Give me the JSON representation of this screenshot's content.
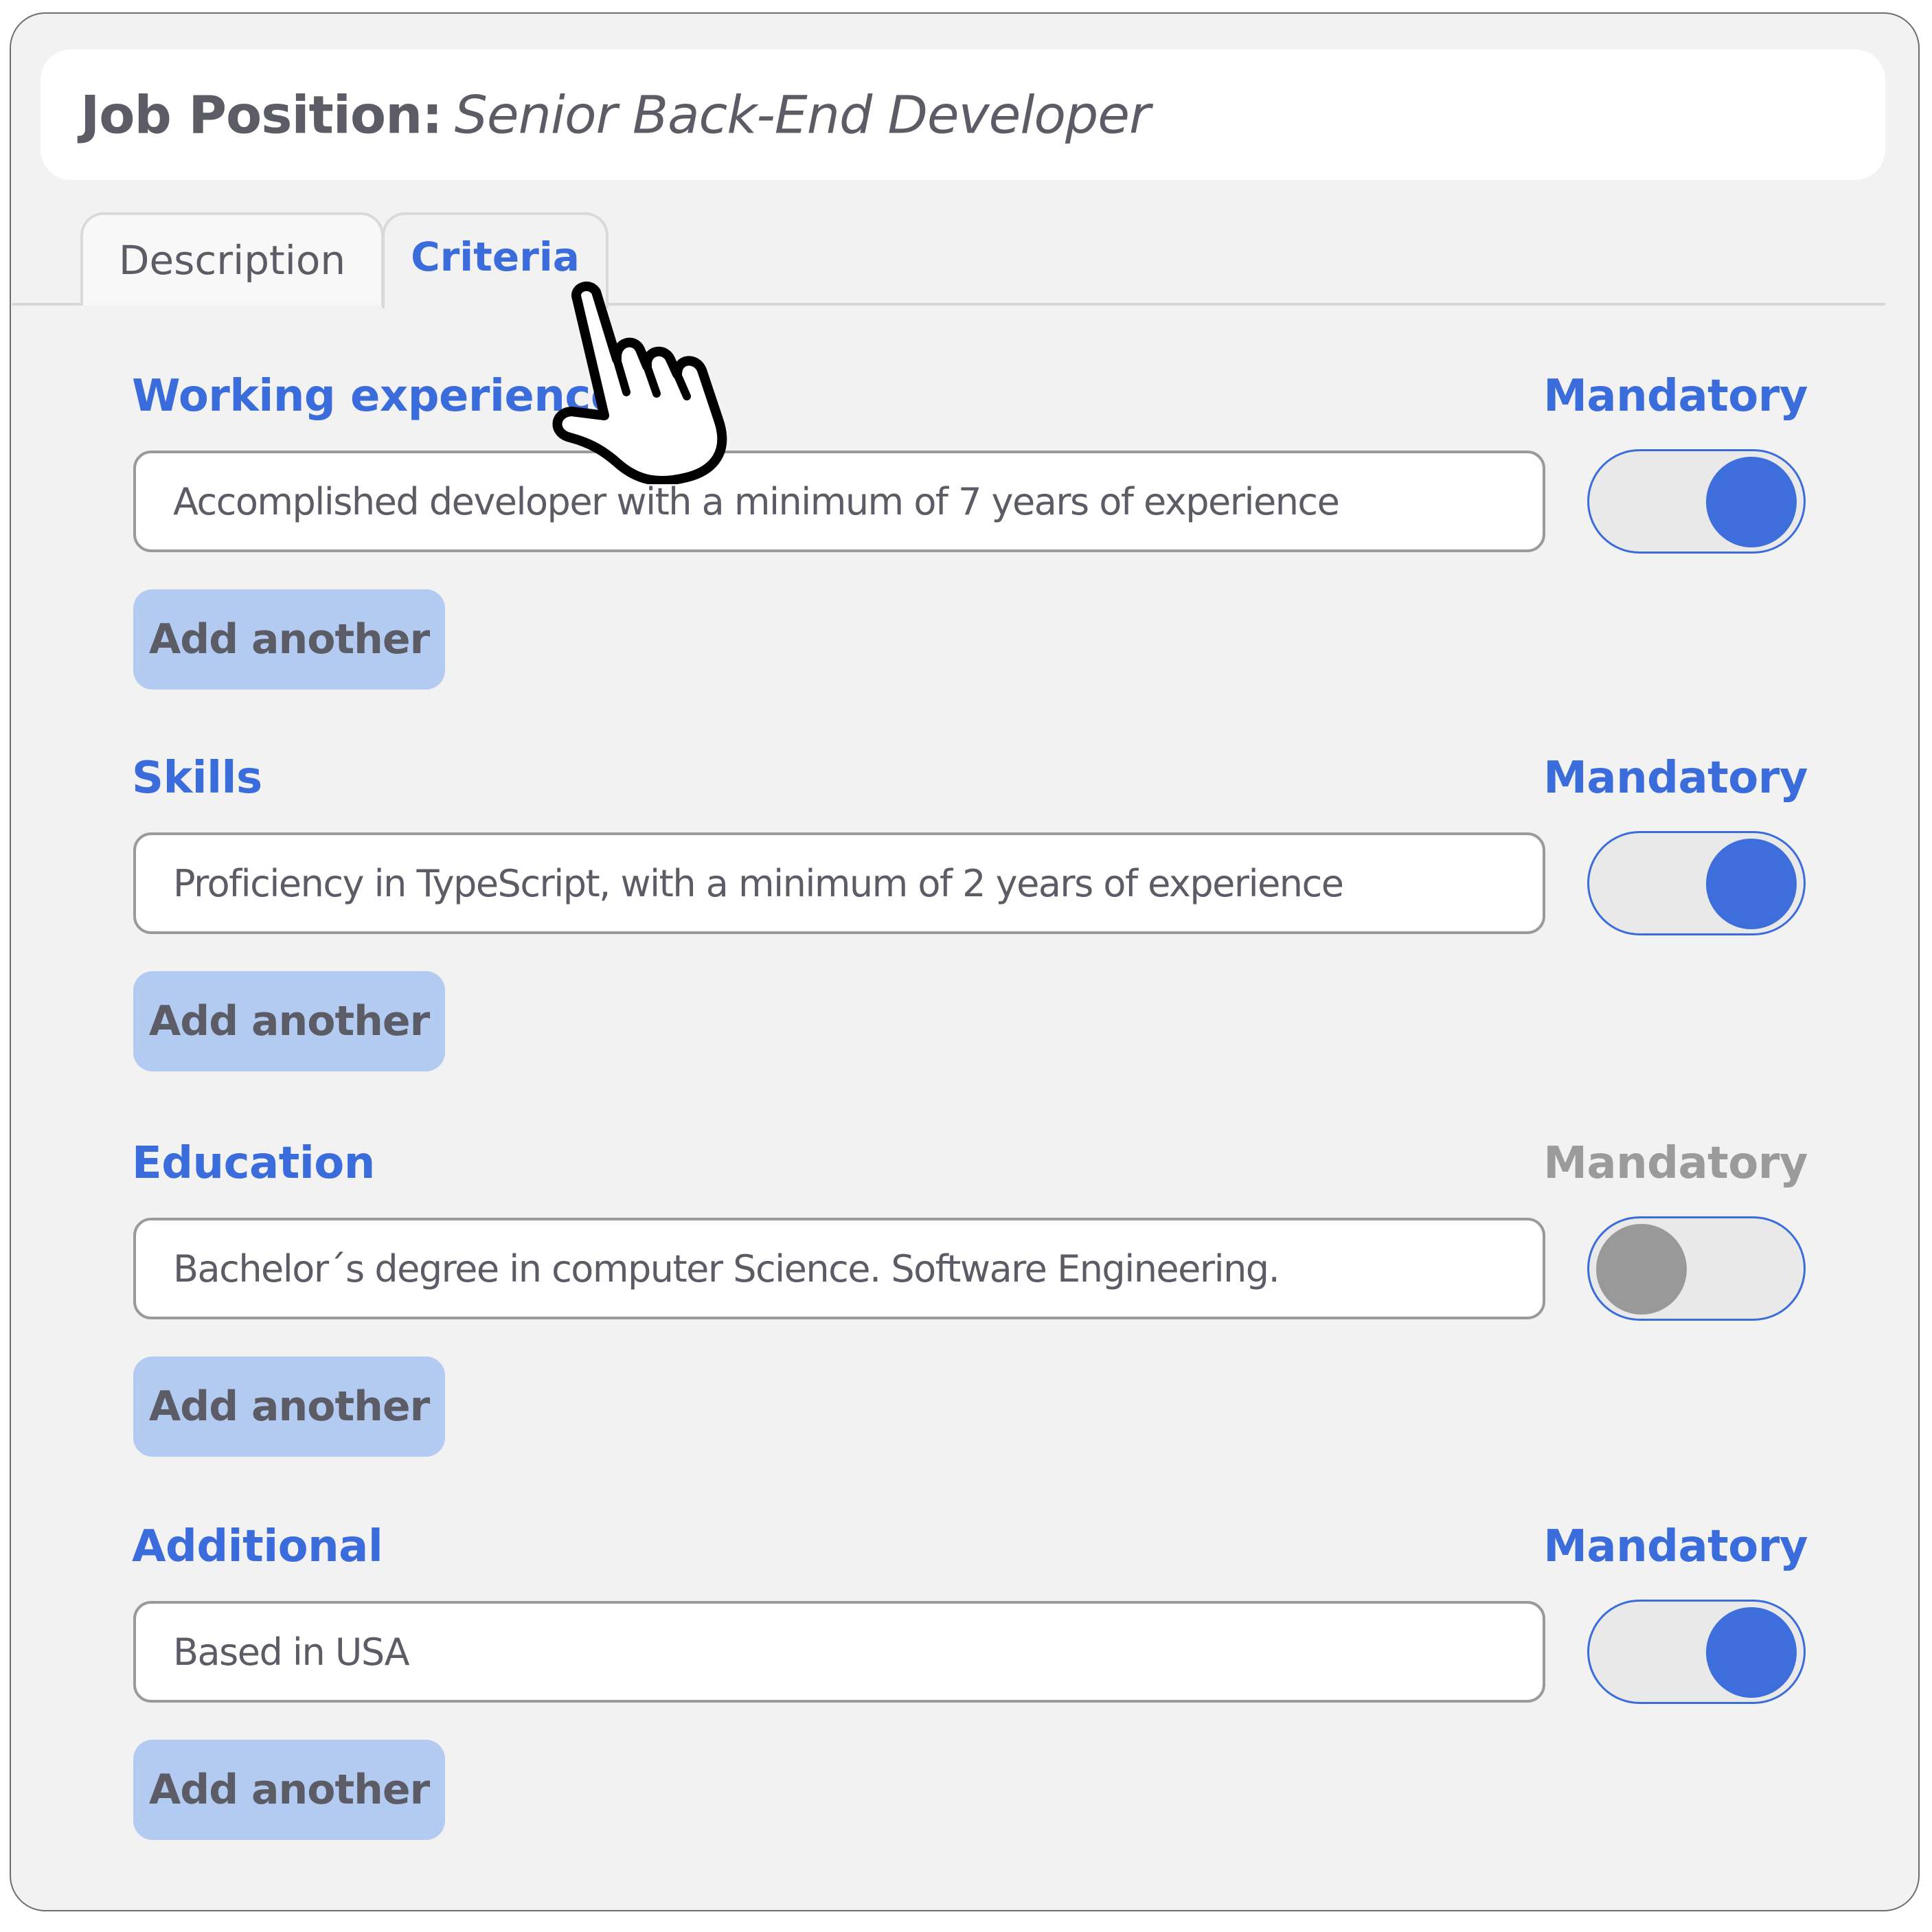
{
  "header": {
    "title_label": "Job Position:",
    "title_value": "Senior Back-End Developer"
  },
  "tabs": [
    {
      "label": "Description",
      "active": false
    },
    {
      "label": "Criteria",
      "active": true
    }
  ],
  "sections": [
    {
      "label": "Working experience",
      "mandatory_label": "Mandatory",
      "mandatory": true,
      "value": "Accomplished developer with a minimum of 7 years of experience",
      "add_label": "Add another"
    },
    {
      "label": "Skills",
      "mandatory_label": "Mandatory",
      "mandatory": true,
      "value": "Proficiency in TypeScript, with a minimum of 2 years of experience",
      "add_label": "Add another"
    },
    {
      "label": "Education",
      "mandatory_label": "Mandatory",
      "mandatory": false,
      "value": "Bachelor´s degree in computer Science. Software Engineering.",
      "add_label": "Add another"
    },
    {
      "label": "Additional",
      "mandatory_label": "Mandatory",
      "mandatory": true,
      "value": "Based in USA",
      "add_label": "Add another"
    }
  ],
  "cursor": {
    "icon": "pointer-hand-icon"
  },
  "colors": {
    "accent": "#3B6CDB",
    "panel_bg": "#F2F2F2",
    "button_bg": "#B4CBF1",
    "text": "#5B5C66",
    "toggle_off_knob": "#999999",
    "toggle_track": "#E9E9E9"
  }
}
